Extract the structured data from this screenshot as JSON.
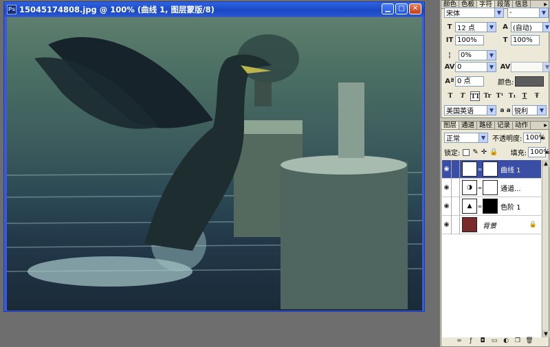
{
  "document": {
    "title": "15045174808.jpg @ 100% (曲线 1, 图层蒙版/8)",
    "app_icon": "Ps"
  },
  "character_panel": {
    "tabs": [
      "颜色",
      "色板",
      "字符",
      "段落",
      "信息"
    ],
    "font_family": "宋体",
    "font_style": "-",
    "font_size": "12 点",
    "leading": "(自动)",
    "vertical_scale": "100%",
    "horizontal_scale": "100%",
    "tracking_kern": "0%",
    "tracking": "0",
    "baseline_shift": "0 点",
    "color_label": "颜色:",
    "style_buttons": [
      "T",
      "T",
      "TT",
      "Tr",
      "T¹",
      "T₁",
      "T",
      "Ŧ"
    ],
    "language": "美国英语",
    "aa_icon": "a a",
    "antialias": "锐利"
  },
  "layers_panel": {
    "tabs": [
      "图层",
      "通道",
      "路径",
      "记录",
      "动作"
    ],
    "blend_mode": "正常",
    "opacity_label": "不透明度:",
    "opacity": "100%",
    "lock_label": "锁定:",
    "fill_label": "填充:",
    "fill": "100%",
    "layers": [
      {
        "name": "曲线 1",
        "type": "curves",
        "mask": "white",
        "selected": true
      },
      {
        "name": "通道...",
        "type": "channel-mixer",
        "mask": "white",
        "selected": false
      },
      {
        "name": "色阶 1",
        "type": "levels",
        "mask": "black",
        "selected": false
      },
      {
        "name": "背景",
        "type": "background",
        "mask": "none",
        "selected": false
      }
    ]
  },
  "icons": {
    "minimize": "minimize-icon",
    "maximize": "maximize-icon",
    "close": "close-icon",
    "eye": "eye-icon",
    "lock": "lock-icon"
  },
  "colors": {
    "titlebar": "#1b48c4",
    "selected_layer": "#3a4ea5",
    "text_color_swatch": "#5c5c5c"
  }
}
